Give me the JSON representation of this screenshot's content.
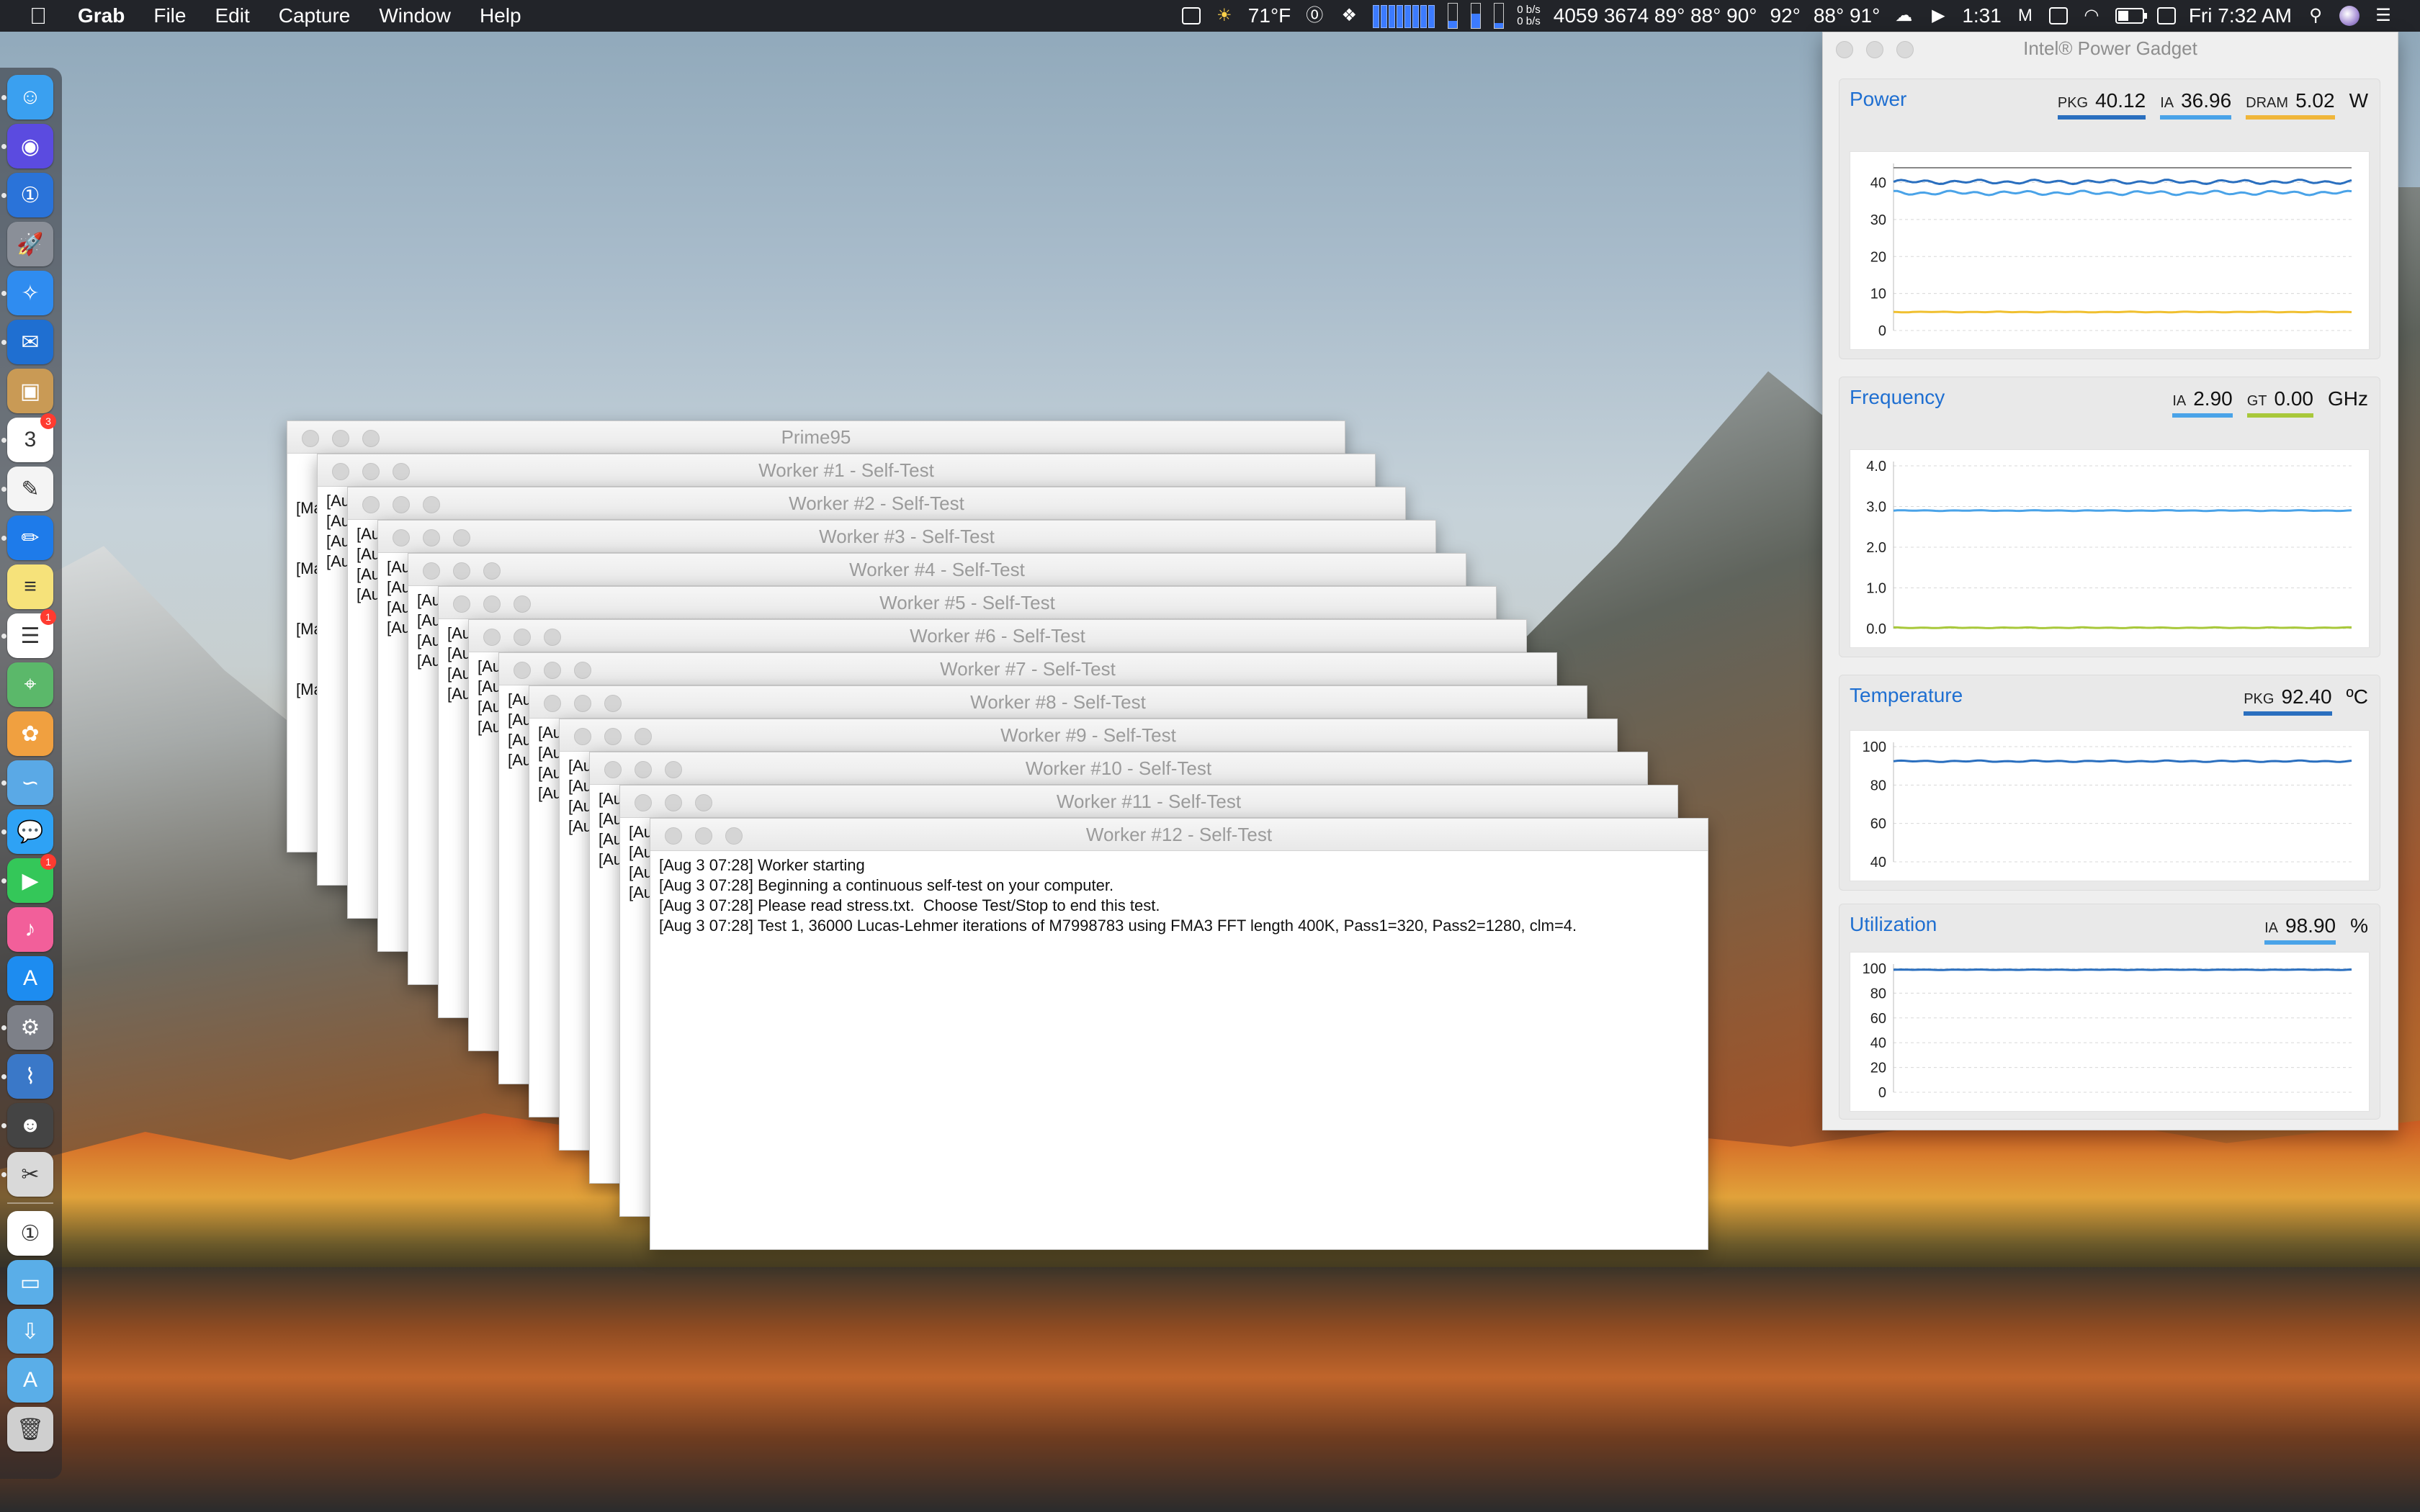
{
  "menubar": {
    "apple": "",
    "app_name": "Grab",
    "menus": [
      "File",
      "Edit",
      "Capture",
      "Window",
      "Help"
    ],
    "weather": "71°F",
    "sensor_text": "4059 3674 89° 88° 90°",
    "temp_a": "92°",
    "temp_b": "88° 91°",
    "net_up": "0 b/s",
    "net_down": "0 b/s",
    "timer": "1:31",
    "clock": "Fri 7:32 AM",
    "icons": [
      "airplay-icon",
      "weather-icon",
      "onepassword-icon",
      "dropbox-icon",
      "cpu-meter-icon",
      "cloud-upload-icon",
      "malwarebytes-icon",
      "display-icon",
      "wifi-icon",
      "battery-icon",
      "calendar-icon",
      "search-icon",
      "siri-icon",
      "notification-center-icon"
    ]
  },
  "dock": {
    "items": [
      {
        "name": "finder",
        "glyph": "☺",
        "color": "#3aa0f0",
        "running": true
      },
      {
        "name": "siri",
        "glyph": "◉",
        "color": "#5b4be0",
        "running": true
      },
      {
        "name": "onepassword",
        "glyph": "①",
        "color": "#2a73d9",
        "running": true
      },
      {
        "name": "launchpad",
        "glyph": "🚀",
        "color": "#8a8f98",
        "running": false
      },
      {
        "name": "safari",
        "glyph": "✧",
        "color": "#2f8cf0",
        "running": true
      },
      {
        "name": "outlook",
        "glyph": "✉",
        "color": "#1f6fd1",
        "running": true
      },
      {
        "name": "archive",
        "glyph": "▣",
        "color": "#c99a55",
        "running": false
      },
      {
        "name": "calendar",
        "glyph": "3",
        "color": "#ffffff",
        "running": true,
        "badge": "3"
      },
      {
        "name": "textedit",
        "glyph": "✎",
        "color": "#f4f4f4",
        "running": true
      },
      {
        "name": "pencil-app",
        "glyph": "✏",
        "color": "#1e7bea",
        "running": true
      },
      {
        "name": "notes",
        "glyph": "≡",
        "color": "#f6e27a",
        "running": false
      },
      {
        "name": "reminders",
        "glyph": "☰",
        "color": "#ffffff",
        "running": true,
        "badge": "1"
      },
      {
        "name": "maps",
        "glyph": "⌖",
        "color": "#5bb86a",
        "running": false
      },
      {
        "name": "photos",
        "glyph": "✿",
        "color": "#f0a040",
        "running": false
      },
      {
        "name": "mustache-app",
        "glyph": "∽",
        "color": "#5aa9e6",
        "running": true
      },
      {
        "name": "messages",
        "glyph": "💬",
        "color": "#2ea2f5",
        "running": true
      },
      {
        "name": "facetime",
        "glyph": "▶",
        "color": "#34c759",
        "running": true,
        "badge": "1"
      },
      {
        "name": "itunes",
        "glyph": "♪",
        "color": "#f25f9a",
        "running": false
      },
      {
        "name": "app-store",
        "glyph": "A",
        "color": "#1d8cf0",
        "running": false
      },
      {
        "name": "system-preferences",
        "glyph": "⚙",
        "color": "#7d8088",
        "running": true
      },
      {
        "name": "power-gadget",
        "glyph": "⌇",
        "color": "#3a78c8",
        "running": true
      },
      {
        "name": "contacts-photo",
        "glyph": "☻",
        "color": "#444444",
        "running": true
      },
      {
        "name": "grab",
        "glyph": "✂",
        "color": "#d9d9d9",
        "running": true
      },
      {
        "name": "onepassword-mini",
        "glyph": "①",
        "color": "#ffffff",
        "running": false
      },
      {
        "name": "folder",
        "glyph": "▭",
        "color": "#5aaee8",
        "running": false
      },
      {
        "name": "downloads-folder",
        "glyph": "⇩",
        "color": "#5aaee8",
        "running": false
      },
      {
        "name": "apps-folder",
        "glyph": "A",
        "color": "#5aaee8",
        "running": false
      },
      {
        "name": "trash",
        "glyph": "🗑",
        "color": "#cfcfcf",
        "running": false
      }
    ]
  },
  "prime95": {
    "title": "Prime95",
    "lines": [
      "[Ma",
      "[Ma",
      "[Ma",
      "[Ma"
    ]
  },
  "workers": [
    {
      "title": "Worker #1 - Self-Test",
      "lines": [
        "[Au",
        "[Au",
        "[Au",
        "[Au"
      ]
    },
    {
      "title": "Worker #2 - Self-Test",
      "lines": [
        "[Au",
        "[Au",
        "[Au",
        "[Au"
      ]
    },
    {
      "title": "Worker #3 - Self-Test",
      "lines": [
        "[Au",
        "[Au",
        "[Au",
        "[Au"
      ]
    },
    {
      "title": "Worker #4 - Self-Test",
      "lines": [
        "[Au",
        "[Au",
        "[Au",
        "[Au"
      ]
    },
    {
      "title": "Worker #5 - Self-Test",
      "lines": [
        "[Au",
        "[Au",
        "[Au",
        "[Au"
      ]
    },
    {
      "title": "Worker #6 - Self-Test",
      "lines": [
        "[Au",
        "[Au",
        "[Au",
        "[Au"
      ]
    },
    {
      "title": "Worker #7 - Self-Test",
      "lines": [
        "[Au",
        "[Au",
        "[Au",
        "[Au"
      ]
    },
    {
      "title": "Worker #8 - Self-Test",
      "lines": [
        "[Au",
        "[Au",
        "[Au",
        "[Au"
      ]
    },
    {
      "title": "Worker #9 - Self-Test",
      "lines": [
        "[Au",
        "[Au",
        "[Au",
        "[Au"
      ]
    },
    {
      "title": "Worker #10 - Self-Test",
      "lines": [
        "[Au",
        "[Au",
        "[Au",
        "[Au"
      ]
    },
    {
      "title": "Worker #11 - Self-Test",
      "lines": [
        "[Au",
        "[Au",
        "[Au",
        "[Au"
      ]
    },
    {
      "title": "Worker #12 - Self-Test",
      "lines": [
        "[Aug 3 07:28] Worker starting",
        "[Aug 3 07:28] Beginning a continuous self-test on your computer.",
        "[Aug 3 07:28] Please read stress.txt.  Choose Test/Stop to end this test.",
        "[Aug 3 07:28] Test 1, 36000 Lucas-Lehmer iterations of M7998783 using FMA3 FFT length 400K, Pass1=320, Pass2=1280, clm=4."
      ]
    }
  ],
  "power_gadget": {
    "title": "Intel® Power Gadget",
    "panels": {
      "power": {
        "title": "Power",
        "unit": "W",
        "metrics": [
          {
            "label": "PKG",
            "value": "40.12",
            "color": "#2a6fbf"
          },
          {
            "label": "IA",
            "value": "36.96",
            "color": "#4aa3e8"
          },
          {
            "label": "DRAM",
            "value": "5.02",
            "color": "#f0b63a"
          }
        ],
        "yticks": [
          "40",
          "30",
          "20",
          "10",
          "0"
        ],
        "ylim": [
          0,
          44
        ],
        "series": [
          {
            "name": "PKG",
            "color": "#2a6fbf",
            "level": 40.2,
            "jitter": 0.6
          },
          {
            "name": "IA",
            "color": "#4aa3e8",
            "level": 37.2,
            "jitter": 0.6
          },
          {
            "name": "DRAM",
            "color": "#f0c030",
            "level": 5.0,
            "jitter": 0.1
          },
          {
            "name": "limit",
            "color": "#888888",
            "level": 45.0,
            "jitter": 0
          }
        ]
      },
      "frequency": {
        "title": "Frequency",
        "unit": "GHz",
        "metrics": [
          {
            "label": "IA",
            "value": "2.90",
            "color": "#4aa3e8"
          },
          {
            "label": "GT",
            "value": "0.00",
            "color": "#a8c83a"
          }
        ],
        "yticks": [
          "4.0",
          "3.0",
          "2.0",
          "1.0",
          "0.0"
        ],
        "ylim": [
          0,
          4.0
        ],
        "series": [
          {
            "name": "IA",
            "color": "#4aa3e8",
            "level": 2.9,
            "jitter": 0.01
          },
          {
            "name": "GT",
            "color": "#a8c83a",
            "level": 0.02,
            "jitter": 0.01
          }
        ]
      },
      "temperature": {
        "title": "Temperature",
        "unit": "ºC",
        "metrics": [
          {
            "label": "PKG",
            "value": "92.40",
            "color": "#2a6fbf"
          }
        ],
        "yticks": [
          "100",
          "80",
          "60",
          "40"
        ],
        "ylim": [
          40,
          100
        ],
        "series": [
          {
            "name": "PKG",
            "color": "#2a6fbf",
            "level": 92.4,
            "jitter": 0.4
          }
        ]
      },
      "utilization": {
        "title": "Utilization",
        "unit": "%",
        "metrics": [
          {
            "label": "IA",
            "value": "98.90",
            "color": "#4aa3e8"
          }
        ],
        "yticks": [
          "100",
          "80",
          "60",
          "40",
          "20",
          "0"
        ],
        "ylim": [
          0,
          100
        ],
        "series": [
          {
            "name": "IA",
            "color": "#2a6fbf",
            "level": 98.9,
            "jitter": 0.2
          }
        ]
      }
    }
  }
}
